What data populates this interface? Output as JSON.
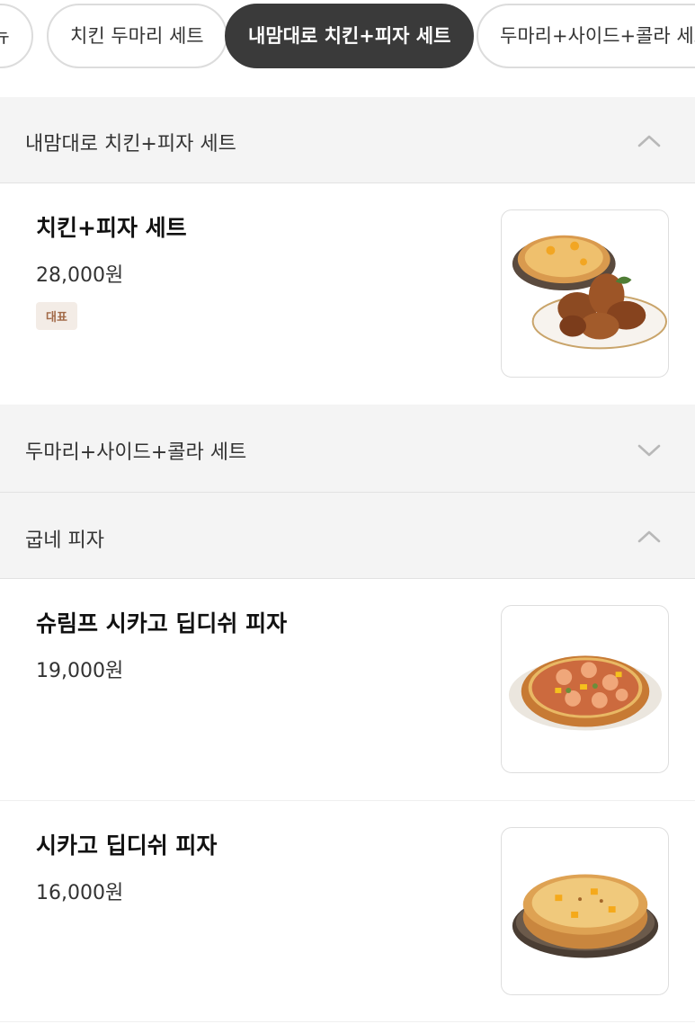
{
  "chips": [
    {
      "label": "메뉴",
      "active": false
    },
    {
      "label": "치킨 두마리 세트",
      "active": false
    },
    {
      "label": "내맘대로 치킨+피자 세트",
      "active": true
    },
    {
      "label": "두마리+사이드+콜라 세트",
      "active": false
    }
  ],
  "sections": [
    {
      "title": "내맘대로 치킨+피자 세트",
      "expanded": true,
      "items": [
        {
          "name": "치킨+피자 세트",
          "price": "28,000원",
          "badge": "대표",
          "image": "chicken-pizza-set-photo"
        }
      ]
    },
    {
      "title": "두마리+사이드+콜라 세트",
      "expanded": false,
      "items": []
    },
    {
      "title": "굽네 피자",
      "expanded": true,
      "items": [
        {
          "name": "슈림프 시카고 딥디쉬 피자",
          "price": "19,000원",
          "image": "shrimp-pizza-photo"
        },
        {
          "name": "시카고 딥디쉬 피자",
          "price": "16,000원",
          "image": "deep-dish-pizza-photo"
        }
      ]
    }
  ],
  "icons": {
    "expanded": "chevron-up-icon",
    "collapsed": "chevron-down-icon"
  },
  "colors": {
    "active_chip": "#3a3a3a",
    "section_bg": "#f4f4f4",
    "badge_bg": "#f3ece6",
    "badge_text": "#a26a48"
  }
}
